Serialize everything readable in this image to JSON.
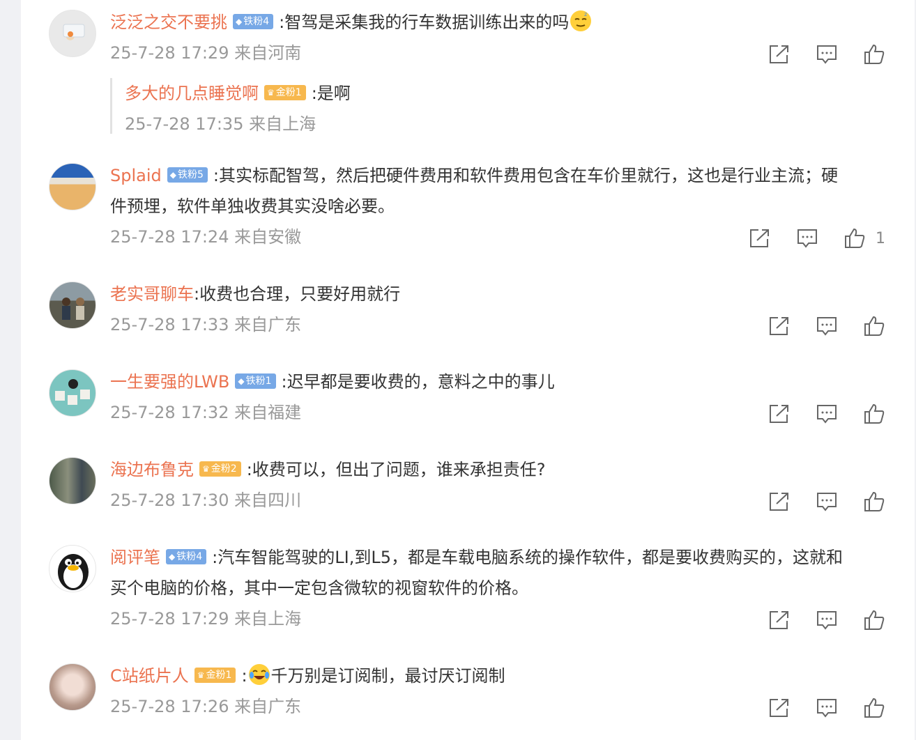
{
  "comments": [
    {
      "user": "泛泛之交不要挑",
      "badge": "铁粉4",
      "badge_type": "iron",
      "text": ":智驾是采集我的行车数据训练出来的吗",
      "emoji_after": "sleepy-emoji",
      "time": "25-7-28 17:29 来自河南",
      "likes": ""
    },
    {
      "user": "Splaid",
      "badge": "铁粉5",
      "badge_type": "iron",
      "text": ":其实标配智驾，然后把硬件费用和软件费用包含在车价里就行，这也是行业主流；硬",
      "text2": "件预埋，软件单独收费其实没啥必要。",
      "time": "25-7-28 17:24 来自安徽",
      "likes": "1"
    },
    {
      "user": "老实哥聊车",
      "badge": "",
      "text": ":收费也合理，只要好用就行",
      "time": "25-7-28 17:33 来自广东",
      "likes": ""
    },
    {
      "user": "一生要强的LWB",
      "badge": "铁粉1",
      "badge_type": "iron",
      "text": ":迟早都是要收费的，意料之中的事儿",
      "time": "25-7-28 17:32 来自福建",
      "likes": ""
    },
    {
      "user": "海边布鲁克",
      "badge": "金粉2",
      "badge_type": "gold",
      "text": ":收费可以，但出了问题，谁来承担责任?",
      "time": "25-7-28 17:30 来自四川",
      "likes": ""
    },
    {
      "user": "阅评笔",
      "badge": "铁粉4",
      "badge_type": "iron",
      "text": ":汽车智能驾驶的LI,到L5，都是车载电脑系统的操作软件，都是要收费购买的，这就和",
      "text2": "买个电脑的价格，其中一定包含微软的视窗软件的价格。",
      "time": "25-7-28 17:29 来自上海",
      "likes": ""
    },
    {
      "user": "C站纸片人",
      "badge": "金粉1",
      "badge_type": "gold",
      "text_prefix": ":",
      "emoji_before": "laughing-tears-emoji",
      "text": "千万别是订阅制，最讨厌订阅制",
      "time": "25-7-28 17:26 来自广东",
      "likes": ""
    }
  ],
  "reply": {
    "user": "多大的几点睡觉啊",
    "badge": "金粉1",
    "badge_type": "gold",
    "text": ":是啊",
    "time": "25-7-28 17:35 来自上海"
  },
  "colors": {
    "username": "#eb7350",
    "meta": "#999999",
    "iron_badge": "#77a8e6",
    "gold_badge": "#f7b84e"
  }
}
